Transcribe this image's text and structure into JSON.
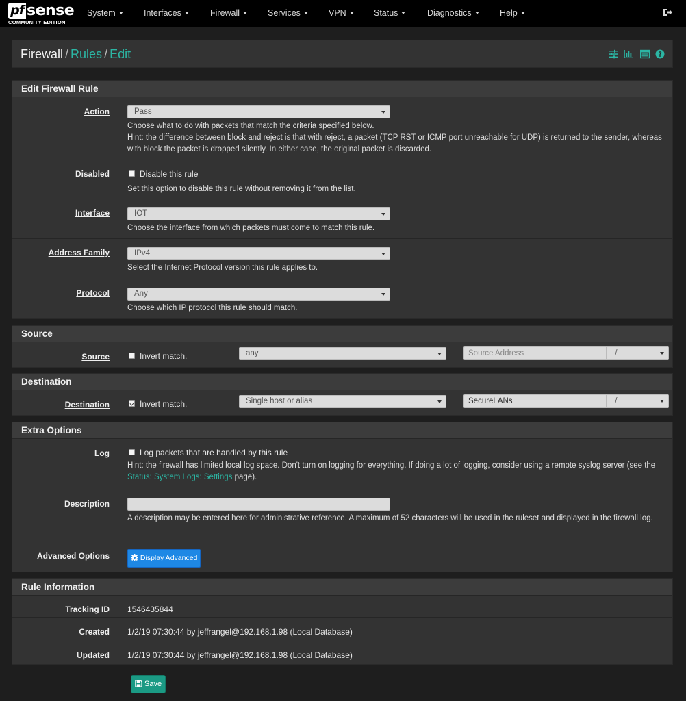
{
  "brand": {
    "mark": "pf",
    "name": "sense",
    "edition": "COMMUNITY EDITION"
  },
  "nav": {
    "items": [
      {
        "label": "System"
      },
      {
        "label": "Interfaces"
      },
      {
        "label": "Firewall"
      },
      {
        "label": "Services"
      },
      {
        "label": "VPN"
      },
      {
        "label": "Status"
      },
      {
        "label": "Diagnostics"
      },
      {
        "label": "Help"
      }
    ]
  },
  "breadcrumb": {
    "root": "Firewall",
    "sep": "/",
    "level1": "Rules",
    "level2": "Edit"
  },
  "edit_rule": {
    "heading": "Edit Firewall Rule",
    "action": {
      "label": "Action",
      "value": "Pass",
      "help1": "Choose what to do with packets that match the criteria specified below.",
      "help2": "Hint: the difference between block and reject is that with reject, a packet (TCP RST or ICMP port unreachable for UDP) is returned to the sender, whereas with block the packet is dropped silently. In either case, the original packet is discarded."
    },
    "disabled": {
      "label": "Disabled",
      "checkbox": "Disable this rule",
      "checked": false,
      "help": "Set this option to disable this rule without removing it from the list."
    },
    "interface": {
      "label": "Interface",
      "value": "IOT",
      "help": "Choose the interface from which packets must come to match this rule."
    },
    "address_family": {
      "label": "Address Family",
      "value": "IPv4",
      "help": "Select the Internet Protocol version this rule applies to."
    },
    "protocol": {
      "label": "Protocol",
      "value": "Any",
      "help": "Choose which IP protocol this rule should match."
    }
  },
  "source": {
    "heading": "Source",
    "label": "Source",
    "invert": "Invert match.",
    "invert_checked": false,
    "type": "any",
    "address_placeholder": "Source Address",
    "slash": "/"
  },
  "destination": {
    "heading": "Destination",
    "label": "Destination",
    "invert": "Invert match.",
    "invert_checked": true,
    "type": "Single host or alias",
    "address": "SecureLANs",
    "slash": "/"
  },
  "extra": {
    "heading": "Extra Options",
    "log": {
      "label": "Log",
      "checkbox": "Log packets that are handled by this rule",
      "checked": false,
      "help_a": "Hint: the firewall has limited local log space. Don't turn on logging for everything. If doing a lot of logging, consider using a remote syslog server (see the",
      "help_link": "Status: System Logs: Settings",
      "help_b": "page)."
    },
    "description": {
      "label": "Description",
      "value": "",
      "help": "A description may be entered here for administrative reference. A maximum of 52 characters will be used in the ruleset and displayed in the firewall log."
    },
    "advanced": {
      "label": "Advanced Options",
      "button": "Display Advanced"
    }
  },
  "rule_info": {
    "heading": "Rule Information",
    "tracking": {
      "label": "Tracking ID",
      "value": "1546435844"
    },
    "created": {
      "label": "Created",
      "value": "1/2/19 07:30:44 by jeffrangel@192.168.1.98 (Local Database)"
    },
    "updated": {
      "label": "Updated",
      "value": "1/2/19 07:30:44 by jeffrangel@192.168.1.98 (Local Database)"
    }
  },
  "save_label": "Save",
  "colors": {
    "accent": "#2cb6a4",
    "button_blue": "#1e88e5",
    "save_green": "#1b9a84"
  }
}
